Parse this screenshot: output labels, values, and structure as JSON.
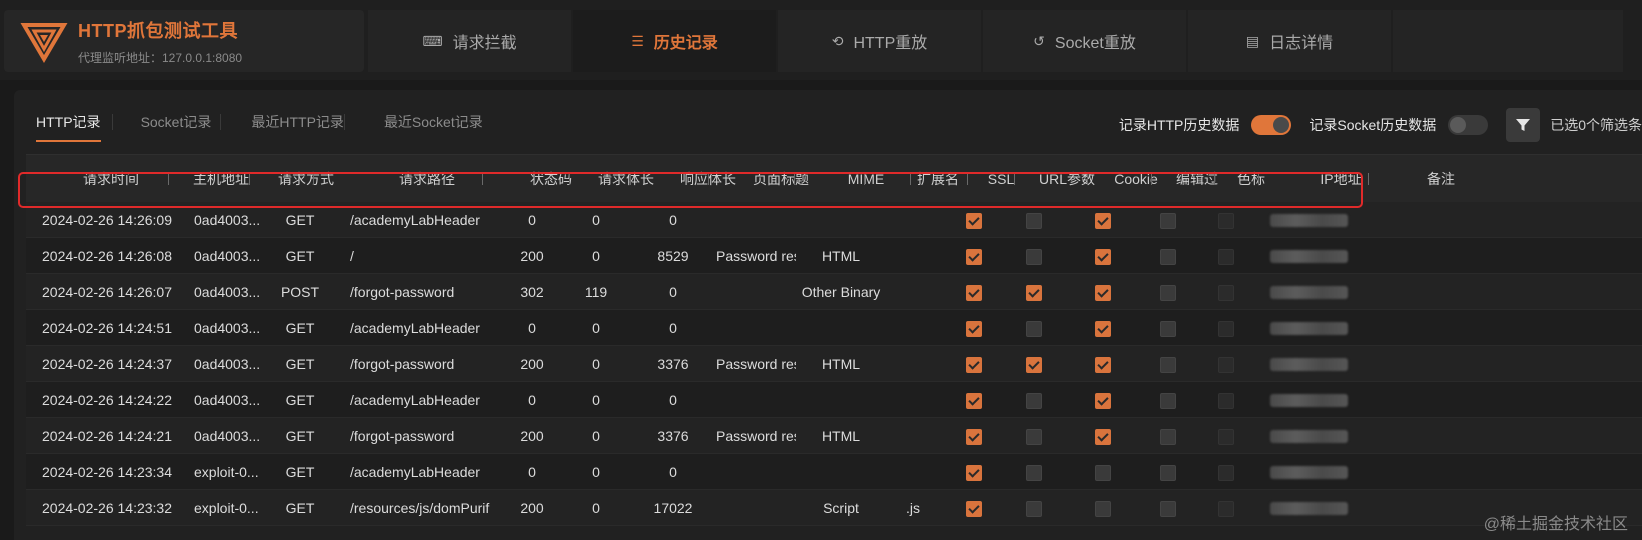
{
  "app": {
    "title": "HTTP抓包测试工具",
    "subtitle": "代理监听地址：127.0.0.1:8080",
    "accent": "#e0763a"
  },
  "nav": {
    "tabs": [
      {
        "label": "请求拦截",
        "icon": "intercept-icon"
      },
      {
        "label": "历史记录",
        "icon": "history-icon",
        "active": true
      },
      {
        "label": "HTTP重放",
        "icon": "replay-icon"
      },
      {
        "label": "Socket重放",
        "icon": "socket-replay-icon"
      },
      {
        "label": "日志详情",
        "icon": "log-icon"
      }
    ]
  },
  "subtabs": [
    {
      "label": "HTTP记录",
      "active": true
    },
    {
      "label": "Socket记录"
    },
    {
      "label": "最近HTTP记录"
    },
    {
      "label": "最近Socket记录"
    }
  ],
  "controls": {
    "record_http_label": "记录HTTP历史数据",
    "record_http_on": true,
    "record_socket_label": "记录Socket历史数据",
    "record_socket_on": false,
    "filter_text": "已选0个筛选条"
  },
  "table": {
    "columns": [
      "请求时间",
      "主机地址",
      "请求方式",
      "请求路径",
      "状态码",
      "请求体长",
      "响应体长",
      "页面标题",
      "MIME",
      "扩展名",
      "SSL",
      "URL参数",
      "Cookie",
      "编辑过",
      "色标",
      "IP地址",
      "备注"
    ],
    "rows": [
      {
        "time": "2024-02-26 14:26:09",
        "host": "0ad4003...",
        "method": "GET",
        "path": "/academyLabHeader",
        "status": "0",
        "req_len": "0",
        "resp_len": "0",
        "title": "",
        "mime": "",
        "ext": "",
        "ssl": true,
        "url_params": false,
        "cookie": true,
        "edited": false
      },
      {
        "time": "2024-02-26 14:26:08",
        "host": "0ad4003...",
        "method": "GET",
        "path": "/",
        "status": "200",
        "req_len": "0",
        "resp_len": "8529",
        "title": "Password rese",
        "mime": "HTML",
        "ext": "",
        "ssl": true,
        "url_params": false,
        "cookie": true,
        "edited": false
      },
      {
        "time": "2024-02-26 14:26:07",
        "host": "0ad4003...",
        "method": "POST",
        "path": "/forgot-password",
        "status": "302",
        "req_len": "119",
        "resp_len": "0",
        "title": "",
        "mime": "Other Binary",
        "ext": "",
        "ssl": true,
        "url_params": true,
        "cookie": true,
        "edited": false
      },
      {
        "time": "2024-02-26 14:24:51",
        "host": "0ad4003...",
        "method": "GET",
        "path": "/academyLabHeader",
        "status": "0",
        "req_len": "0",
        "resp_len": "0",
        "title": "",
        "mime": "",
        "ext": "",
        "ssl": true,
        "url_params": false,
        "cookie": true,
        "edited": false
      },
      {
        "time": "2024-02-26 14:24:37",
        "host": "0ad4003...",
        "method": "GET",
        "path": "/forgot-password",
        "status": "200",
        "req_len": "0",
        "resp_len": "3376",
        "title": "Password rese",
        "mime": "HTML",
        "ext": "",
        "ssl": true,
        "url_params": true,
        "cookie": true,
        "edited": false
      },
      {
        "time": "2024-02-26 14:24:22",
        "host": "0ad4003...",
        "method": "GET",
        "path": "/academyLabHeader",
        "status": "0",
        "req_len": "0",
        "resp_len": "0",
        "title": "",
        "mime": "",
        "ext": "",
        "ssl": true,
        "url_params": false,
        "cookie": true,
        "edited": false
      },
      {
        "time": "2024-02-26 14:24:21",
        "host": "0ad4003...",
        "method": "GET",
        "path": "/forgot-password",
        "status": "200",
        "req_len": "0",
        "resp_len": "3376",
        "title": "Password rese",
        "mime": "HTML",
        "ext": "",
        "ssl": true,
        "url_params": false,
        "cookie": true,
        "edited": false
      },
      {
        "time": "2024-02-26 14:23:34",
        "host": "exploit-0...",
        "method": "GET",
        "path": "/academyLabHeader",
        "status": "0",
        "req_len": "0",
        "resp_len": "0",
        "title": "",
        "mime": "",
        "ext": "",
        "ssl": true,
        "url_params": false,
        "cookie": false,
        "edited": false
      },
      {
        "time": "2024-02-26 14:23:32",
        "host": "exploit-0...",
        "method": "GET",
        "path": "/resources/js/domPurif...",
        "status": "200",
        "req_len": "0",
        "resp_len": "17022",
        "title": "",
        "mime": "Script",
        "ext": ".js",
        "ssl": true,
        "url_params": false,
        "cookie": false,
        "edited": false
      }
    ]
  },
  "watermark": "@稀土掘金技术社区"
}
